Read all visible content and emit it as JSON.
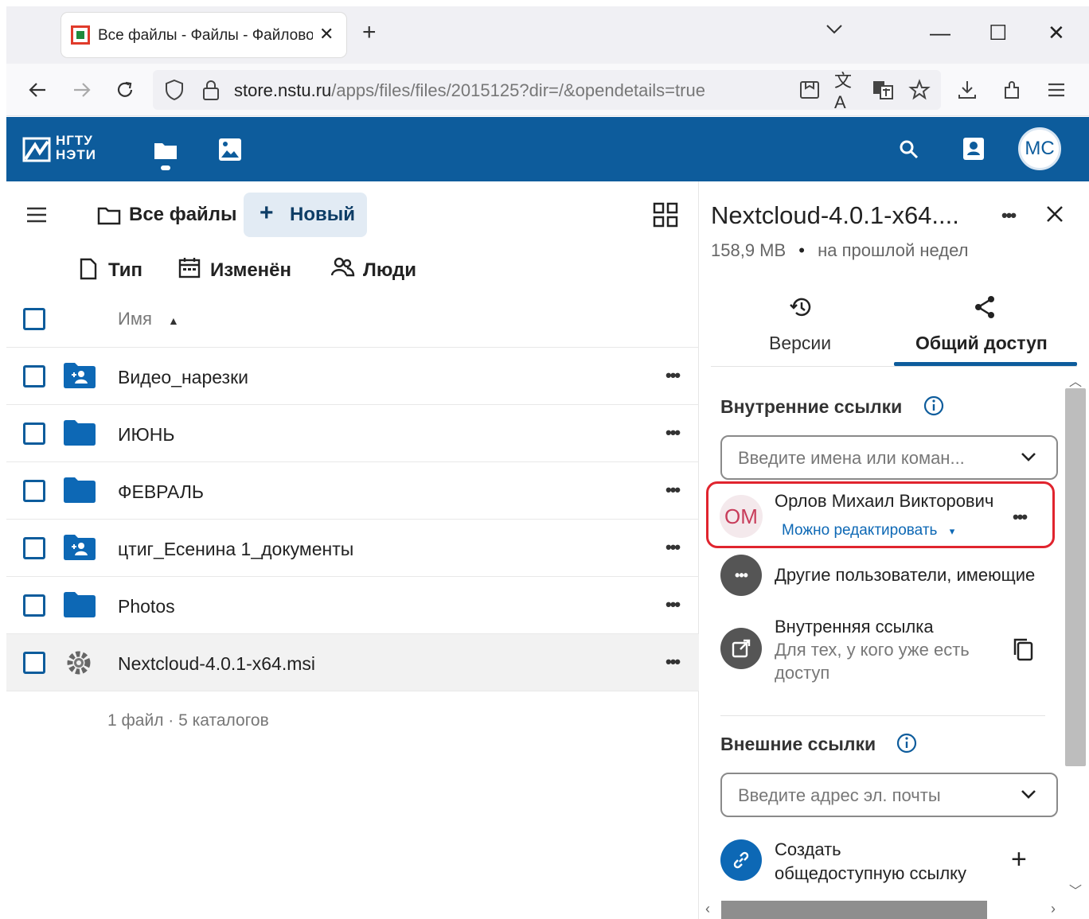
{
  "browser": {
    "tab_title": "Все файлы - Файлы - Файлово",
    "tab_close": "✕",
    "new_tab": "+",
    "url_host": "store.nstu.ru",
    "url_path": "/apps/files/files/2015125?dir=/&opendetails=true",
    "window_controls": {
      "tab_list": "⌵",
      "minimize": "—",
      "maximize": "☐",
      "close": "✕"
    }
  },
  "app_header": {
    "logo_line1": "НГТУ",
    "logo_line2": "НЭТИ",
    "avatar_initials": "МС",
    "brand_color": "#0d5c9c",
    "icons": [
      "files-icon",
      "photos-icon",
      "search-icon",
      "contacts-icon"
    ]
  },
  "files": {
    "breadcrumb": "Все файлы",
    "new_button": "Новый",
    "filters": {
      "type": "Тип",
      "modified": "Изменён",
      "people": "Люди"
    },
    "column_name": "Имя",
    "rows": [
      {
        "name": "Видео_нарезки",
        "icon": "shared-folder-icon"
      },
      {
        "name": "ИЮНЬ",
        "icon": "folder-icon"
      },
      {
        "name": "ФЕВРАЛЬ",
        "icon": "folder-icon"
      },
      {
        "name": "цтиг_Есенина 1_документы",
        "icon": "shared-folder-icon"
      },
      {
        "name": "Photos",
        "icon": "folder-icon"
      },
      {
        "name": "Nextcloud-4.0.1-x64.msi",
        "icon": "gear-file-icon"
      }
    ],
    "row_menu": "•••",
    "summary": "1 файл · 5 каталогов"
  },
  "details": {
    "title": "Nextcloud-4.0.1-x64....",
    "size": "158,9 MB",
    "bullet": "•",
    "modified": "на прошлой недел",
    "menu": "•••",
    "tabs": {
      "versions": "Версии",
      "sharing": "Общий доступ"
    },
    "internal_section": "Внутренние ссылки",
    "internal_placeholder": "Введите имена или коман...",
    "share_user_initials": "ОМ",
    "share_user_name": "Орлов Михаил Викторович",
    "share_permission": "Можно редактировать",
    "share_permission_caret": "▾",
    "others_text": "Другие пользователи, имеющие",
    "internal_link_title": "Внутренняя ссылка",
    "internal_link_desc_1": "Для тех, у кого уже есть",
    "internal_link_desc_2": "доступ",
    "external_section": "Внешние ссылки",
    "external_placeholder": "Введите адрес эл. почты",
    "public_link_1": "Создать",
    "public_link_2": "общедоступную ссылку",
    "add": "+"
  }
}
